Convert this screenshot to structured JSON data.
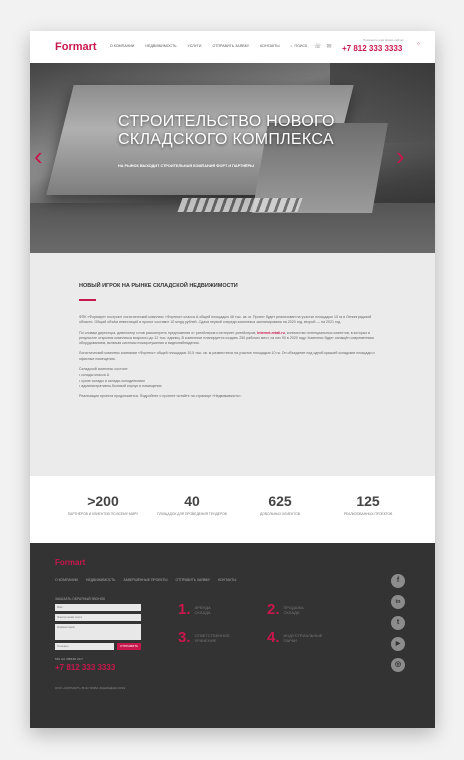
{
  "header": {
    "logo": "Formart",
    "nav": [
      "О КОМПАНИИ",
      "НЕДВИЖИМОСТЬ",
      "УСЛУГИ",
      "ОТПРАВИТЬ ЗАЯВКУ",
      "КОНТАКТЫ"
    ],
    "search_label": "ПОИСК",
    "top_small": "Позвоните нам прямо сейчас",
    "phone": "+7 812 333 3333"
  },
  "hero": {
    "title_line1": "СТРОИТЕЛЬСТВО НОВОГО",
    "title_line2": "СКЛАДСКОГО КОМПЛЕКСА",
    "subtitle": "НА РЫНОК ВЫХОДИТ СТРОИТЕЛЬНАЯ КОМПАНИЯ ФОРТ И ПАРТНЁРЫ",
    "prev_arrow": "‹",
    "next_arrow": "›",
    "slides": 5,
    "active_slide": 1
  },
  "article": {
    "title": "НОВЫЙ ИГРОК НА РЫНКЕ СКЛАДСКОЙ НЕДВИЖИМОСТИ",
    "p1": "ФПК «Формарт» построит логистический комплекс «Фортекс» класса А общей площадью 48 тыс. кв. м. Проект будет реализован на участке площадью 10 га в Ленинградской области. Общий объём инвестиций в проект составит 10 млрд рублей. Сдача первой очереди комплекса запланирована на 2020 год, второй — на 2021 год.",
    "p2_prefix": "По словам директора, девелопер готов рассмотреть предложения от ритейлеров и интернет-ритейлеров, ",
    "p2_link": "Internet-retail.ru",
    "p2_suffix": ", количество потенциальных клиентов, в которых в результате открытия комплекса возросло до 12 тыс. единиц. В комплексе планируется создать 250 рабочих мест, из них 90 в 2020 году. Комплекс будет оснащён современным оборудованием, включая системы пожаротушения и видеонаблюдения.",
    "p3": "Логистический комплекс компании «Фортекс» общей площадью 10,5 тыс. кв. м разместится на участке площадью 10 га. Он объединит под одной крышей складские площади и офисные помещения.",
    "list_title": "Складской комплекс состоит:",
    "list": [
      "склады класса А",
      "сухие склады и склады-холодильники",
      "административно-бытовой корпус и помещения"
    ],
    "closing": "Реализация проекта продолжается. Подробнее о проекте читайте на странице «Недвижимость»."
  },
  "stats": [
    {
      "value": ">200",
      "label": "ПАРТНЁРОВ И КЛИЕНТОВ ПО ВСЕМУ МИРУ"
    },
    {
      "value": "40",
      "label": "ПЛОЩАДОК ДЛЯ ПРОВЕДЕНИЯ ТЕНДЕРОВ"
    },
    {
      "value": "625",
      "label": "ДОВОЛЬНЫХ КЛИЕНТОВ"
    },
    {
      "value": "125",
      "label": "РЕАЛИЗОВАННЫХ ПРОЕКТОВ"
    }
  ],
  "footer": {
    "logo": "Formart",
    "nav": [
      "О КОМПАНИИ",
      "НЕДВИЖИМОСТЬ",
      "ЗАВЕРШЁННЫЕ ПРОЕКТЫ",
      "ОТПРАВИТЬ ЗАЯВКУ",
      "КОНТАКТЫ"
    ],
    "form_label": "ЗАКАЗАТЬ ОБРАТНЫЙ ЗВОНОК",
    "placeholders": [
      "Имя",
      "Электронная почта",
      "Комментарий",
      "Телефон"
    ],
    "send": "ОТПРАВИТЬ",
    "phone_label": "МЫ НА СВЯЗИ 24/7",
    "phone": "+7 812 333 3333",
    "copyright": "ООО «ФОРМАРТ» ВСЕ ПРАВА ЗАЩИЩЕНЫ 2019",
    "services": [
      {
        "num": "1.",
        "l1": "АРЕНДА",
        "l2": "СКЛАДА"
      },
      {
        "num": "2.",
        "l1": "ПРОДАЖА",
        "l2": "СКЛАДА"
      },
      {
        "num": "3.",
        "l1": "ОТВЕТСТВЕННОЕ",
        "l2": "ХРАНЕНИЕ"
      },
      {
        "num": "4.",
        "l1": "ИНДУСТРИАЛЬНЫЕ",
        "l2": "ПАРКИ"
      }
    ],
    "social": [
      "f",
      "in",
      "t",
      "▶",
      "◎"
    ]
  }
}
